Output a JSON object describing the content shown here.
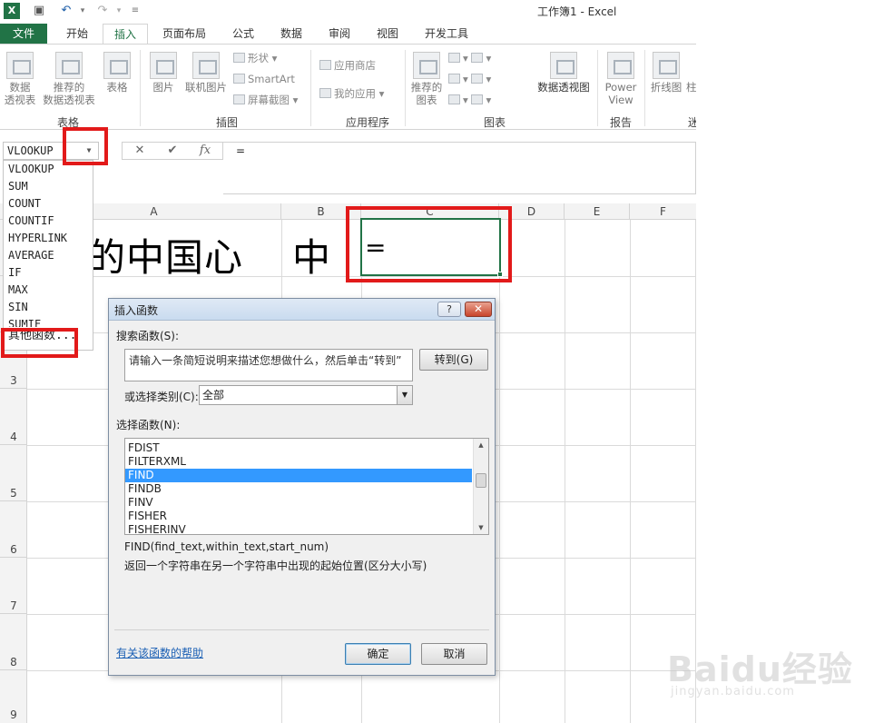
{
  "window": {
    "title": "工作簿1 - Excel"
  },
  "ribbon_tabs": [
    "文件",
    "开始",
    "插入",
    "页面布局",
    "公式",
    "数据",
    "审阅",
    "视图",
    "开发工具"
  ],
  "ribbon": {
    "tables_group": {
      "label": "表格",
      "pivot": "数据\n透视表",
      "recommended_pivot": "推荐的\n数据透视表",
      "table": "表格"
    },
    "illustrations_group": {
      "label": "插图",
      "picture": "图片",
      "online_picture": "联机图片",
      "shapes": "形状",
      "smartart": "SmartArt",
      "screenshot": "屏幕截图"
    },
    "apps_group": {
      "label": "应用程序",
      "store": "应用商店",
      "my_apps": "我的应用"
    },
    "charts_group": {
      "label": "图表",
      "recommended_charts": "推荐的\n图表",
      "pivot_chart": "数据透视图"
    },
    "reports_group": {
      "label": "报告",
      "power_view": "Power\nView"
    },
    "sparklines": {
      "line": "折线图",
      "partial": "柱",
      "partial_group": "迷"
    }
  },
  "formula_bar": {
    "name_box": "VLOOKUP",
    "cancel": "✕",
    "enter": "✔",
    "fx": "fx",
    "value": "="
  },
  "function_dropdown": [
    "VLOOKUP",
    "SUM",
    "COUNT",
    "COUNTIF",
    "HYPERLINK",
    "AVERAGE",
    "IF",
    "MAX",
    "SIN",
    "SUMIF",
    "其他函数..."
  ],
  "columns": [
    "A",
    "B",
    "C",
    "D",
    "E",
    "F"
  ],
  "rows": [
    "3",
    "4",
    "5",
    "6",
    "7",
    "8",
    "9"
  ],
  "cells": {
    "a1": "的中国心",
    "b1": "中",
    "c1": "="
  },
  "dialog": {
    "title": "插入函数",
    "help_button": "?",
    "close_button": "✕",
    "search_label": "搜索函数(S):",
    "search_value": "请输入一条简短说明来描述您想做什么，然后单击“转到”",
    "go_button": "转到(G)",
    "category_label": "或选择类别(C):",
    "category_value": "全部",
    "select_label": "选择函数(N):",
    "functions": [
      "FDIST",
      "FILTERXML",
      "FIND",
      "FINDB",
      "FINV",
      "FISHER",
      "FISHERINV"
    ],
    "selected_function": "FIND",
    "signature": "FIND(find_text,within_text,start_num)",
    "description": "返回一个字符串在另一个字符串中出现的起始位置(区分大小写)",
    "help_link": "有关该函数的帮助",
    "ok_button": "确定",
    "cancel_button": "取消"
  },
  "watermark": {
    "logo": "Baidu经验",
    "url": "jingyan.baidu.com"
  },
  "colors": {
    "excel_green": "#217346",
    "highlight_red": "#e21a1a",
    "selection_blue": "#3399ff"
  }
}
